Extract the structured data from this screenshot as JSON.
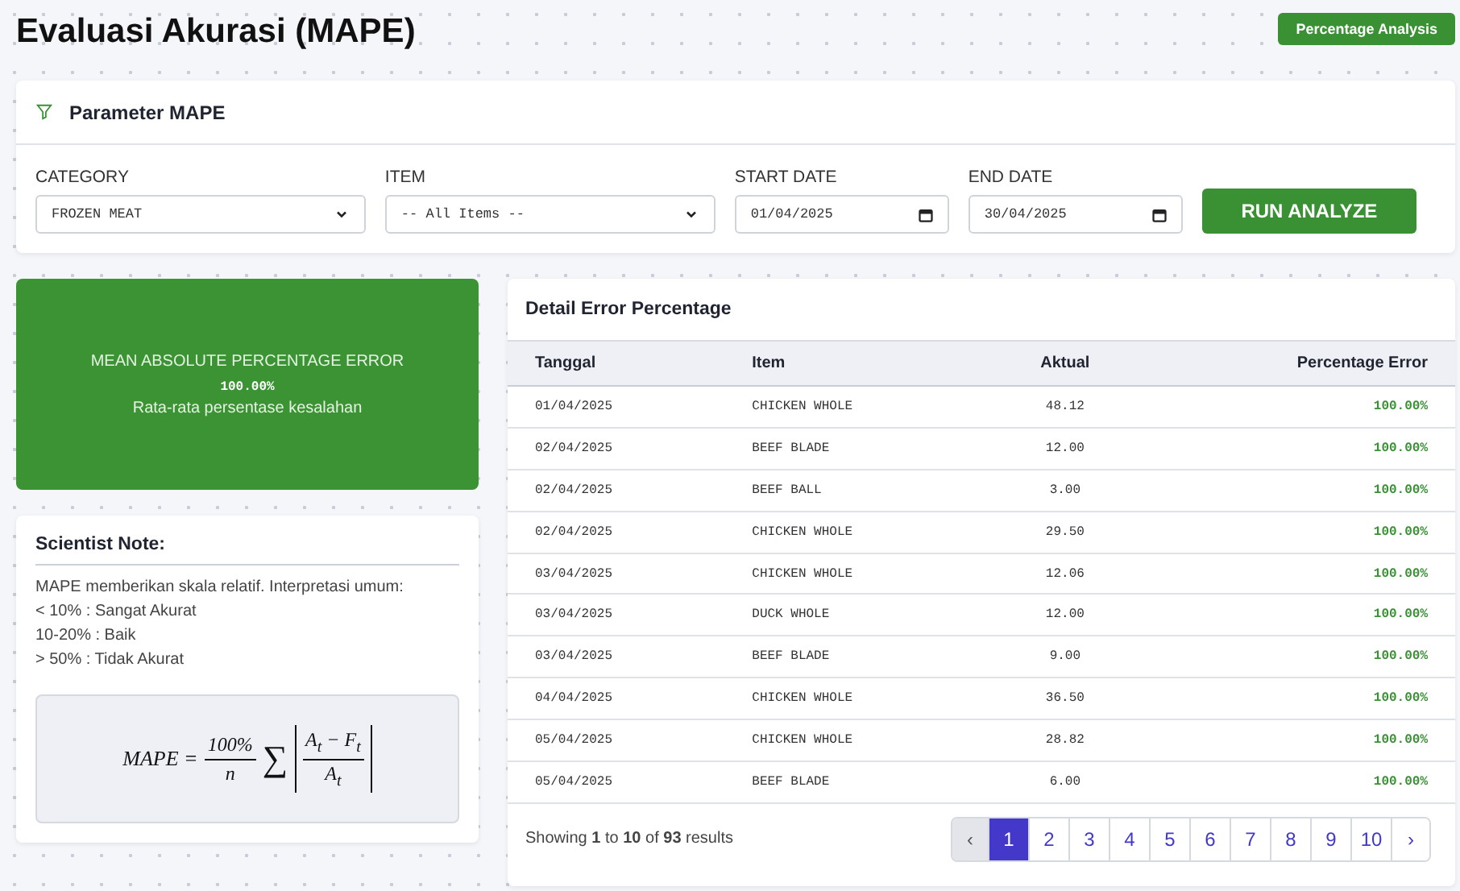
{
  "header": {
    "title": "Evaluasi Akurasi (MAPE)",
    "badge": "Percentage Analysis"
  },
  "parameters": {
    "title": "Parameter MAPE",
    "fields": [
      {
        "kind": "select",
        "label": "CATEGORY",
        "value": "FROZEN MEAT"
      },
      {
        "kind": "select",
        "label": "ITEM",
        "value": "-- All Items --"
      },
      {
        "kind": "date",
        "label": "START DATE",
        "value": "01/04/2025"
      },
      {
        "kind": "date",
        "label": "END DATE",
        "value": "30/04/2025"
      }
    ],
    "button": "RUN ANALYZE"
  },
  "summary": {
    "label": "MEAN ABSOLUTE PERCENTAGE ERROR",
    "value": "100.00%",
    "caption": "Rata-rata persentase kesalahan"
  },
  "note": {
    "title": "Scientist Note:",
    "lines": [
      "MAPE memberikan skala relatif. Interpretasi umum:",
      "< 10% : Sangat Akurat",
      "10-20% : Baik",
      "> 50% : Tidak Akurat"
    ],
    "formula": {
      "lhs": "MAPE =",
      "numerator": "100%",
      "denominator": "n",
      "sum": "∑",
      "inner_numerator": "A$_{t}$ − F$_{t}$",
      "inner_denominator": "A$_{t}$"
    }
  },
  "table": {
    "title": "Detail Error Percentage",
    "columns": [
      "Tanggal",
      "Item",
      "Aktual",
      "Percentage Error"
    ],
    "rows": [
      [
        "01/04/2025",
        "CHICKEN WHOLE",
        "48.12",
        "100.00%"
      ],
      [
        "02/04/2025",
        "BEEF BLADE",
        "12.00",
        "100.00%"
      ],
      [
        "02/04/2025",
        "BEEF BALL",
        "3.00",
        "100.00%"
      ],
      [
        "02/04/2025",
        "CHICKEN WHOLE",
        "29.50",
        "100.00%"
      ],
      [
        "03/04/2025",
        "CHICKEN WHOLE",
        "12.06",
        "100.00%"
      ],
      [
        "03/04/2025",
        "DUCK WHOLE",
        "12.00",
        "100.00%"
      ],
      [
        "03/04/2025",
        "BEEF BLADE",
        "9.00",
        "100.00%"
      ],
      [
        "04/04/2025",
        "CHICKEN WHOLE",
        "36.50",
        "100.00%"
      ],
      [
        "05/04/2025",
        "CHICKEN WHOLE",
        "28.82",
        "100.00%"
      ],
      [
        "05/04/2025",
        "BEEF BLADE",
        "6.00",
        "100.00%"
      ]
    ],
    "footer": "Showing **1** to **10** of **93** results",
    "pagination": {
      "prev": "‹",
      "next": "›",
      "pages": [
        {
          "label": "1",
          "selected": true
        },
        {
          "label": "2",
          "selected": false
        },
        {
          "label": "3",
          "selected": false
        },
        {
          "label": "4",
          "selected": false
        },
        {
          "label": "5",
          "selected": false
        },
        {
          "label": "6",
          "selected": false
        },
        {
          "label": "7",
          "selected": false
        },
        {
          "label": "8",
          "selected": false
        },
        {
          "label": "9",
          "selected": false
        },
        {
          "label": "10",
          "selected": false
        }
      ]
    }
  }
}
